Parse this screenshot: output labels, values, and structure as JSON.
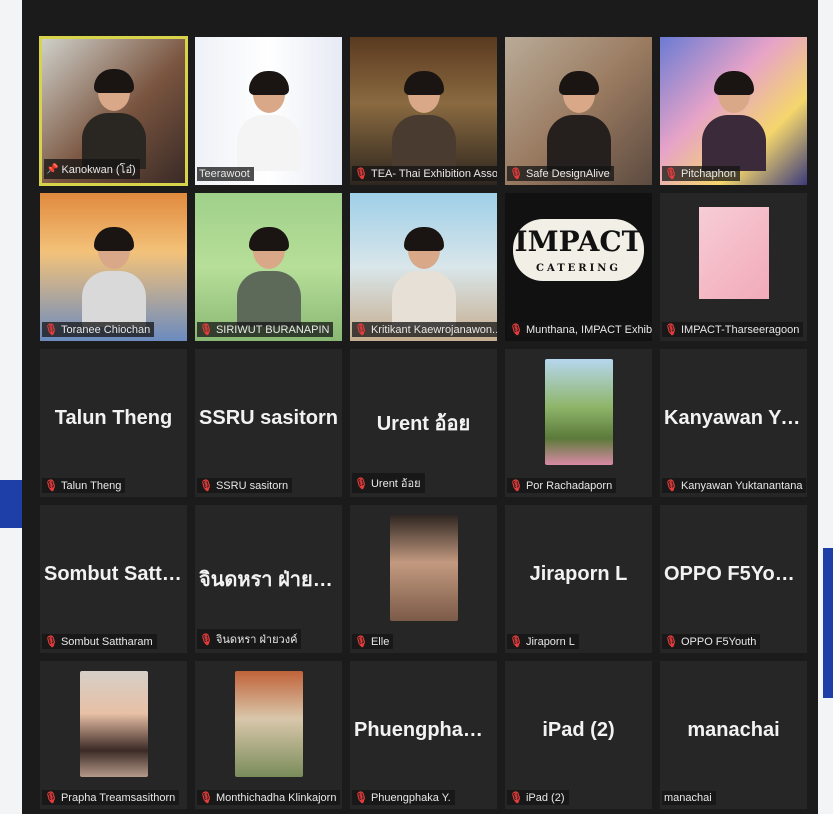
{
  "tiles": [
    {
      "name": "Kanokwan (โอ๋)",
      "big": "",
      "video": "v1",
      "active": true,
      "pinned": true,
      "muted": false
    },
    {
      "name": "Teerawoot",
      "big": "",
      "video": "v2",
      "muted": false
    },
    {
      "name": "TEA- Thai Exhibition Asso...",
      "big": "",
      "video": "v3",
      "muted": true
    },
    {
      "name": "Safe DesignAlive",
      "big": "",
      "video": "v4",
      "muted": true
    },
    {
      "name": "Pitchaphon",
      "big": "",
      "video": "v5",
      "muted": true
    },
    {
      "name": "Toranee Chiochan",
      "big": "",
      "video": "v6",
      "muted": true
    },
    {
      "name": "SIRIWUT BURANAPIN",
      "big": "",
      "video": "v7",
      "muted": true
    },
    {
      "name": "Kritikant Kaewrojanawon...",
      "big": "",
      "video": "v8",
      "muted": true
    },
    {
      "name": "Munthana, IMPACT Exhib...",
      "big": "",
      "video": "v9",
      "muted": true,
      "logo_text": "IMPACT",
      "logo_sub": "CATERING"
    },
    {
      "name": "IMPACT-Tharseeragoon",
      "big": "",
      "video": "v10",
      "muted": true
    },
    {
      "name": "Talun Theng",
      "big": "Talun Theng",
      "muted": true
    },
    {
      "name": "SSRU sasitorn",
      "big": "SSRU sasitorn",
      "muted": true
    },
    {
      "name": "Urent อ้อย",
      "big": "Urent อ้อย",
      "muted": true
    },
    {
      "name": "Por Rachadaporn",
      "big": "",
      "photo": "photo-nature",
      "muted": true
    },
    {
      "name": "Kanyawan Yuktanantana",
      "big": "Kanyawan  Yukt...",
      "muted": true
    },
    {
      "name": "Sombut Sattharam",
      "big": "Sombut  Satthar...",
      "muted": true
    },
    {
      "name": "จินดหรา ฝ่ายวงค์",
      "big": "จินดหรา ฝ่ายวงค์",
      "muted": true
    },
    {
      "name": "Elle",
      "big": "",
      "photo": "photo-woman",
      "muted": true
    },
    {
      "name": "Jiraporn L",
      "big": "Jiraporn L",
      "muted": true
    },
    {
      "name": "OPPO F5Youth",
      "big": "OPPO F5Youth",
      "muted": true
    },
    {
      "name": "Prapha Treamsasithorn",
      "big": "",
      "photo": "photo-avatar",
      "muted": true
    },
    {
      "name": "Monthichadha Klinkajorn",
      "big": "",
      "photo": "photo-arch",
      "muted": true
    },
    {
      "name": "Phuengphaka Y.",
      "big": "Phuengphaka Y.",
      "muted": true
    },
    {
      "name": "iPad (2)",
      "big": "iPad (2)",
      "muted": true
    },
    {
      "name": "manachai",
      "big": "manachai",
      "muted": false
    }
  ],
  "icons": {
    "muted": "mic-off-icon",
    "pinned": "pin-icon"
  },
  "colors": {
    "active_border": "#d7d34b",
    "mic_off": "#e23b3b",
    "tile_bg": "#262626"
  }
}
